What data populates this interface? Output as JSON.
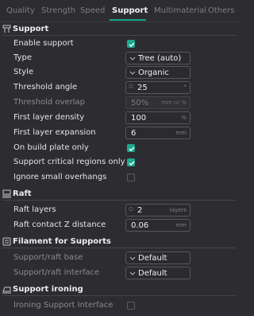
{
  "tabs": {
    "quality": "Quality",
    "strength": "Strength",
    "speed": "Speed",
    "support": "Support",
    "multimaterial": "Multimaterial",
    "others": "Others"
  },
  "colors": {
    "accent": "#1fa88d",
    "background": "#2d2d31"
  },
  "sections": {
    "support": {
      "title": "Support",
      "icon": "support-icon",
      "enable_support": {
        "label": "Enable support",
        "checked": true
      },
      "type": {
        "label": "Type",
        "value": "Tree (auto)"
      },
      "style": {
        "label": "Style",
        "value": "Organic"
      },
      "threshold_angle": {
        "label": "Threshold angle",
        "value": "25",
        "unit": "°"
      },
      "threshold_overlap": {
        "label": "Threshold overlap",
        "value": "50%",
        "unit": "mm or %"
      },
      "first_layer_density": {
        "label": "First layer density",
        "value": "100",
        "unit": "%"
      },
      "first_layer_expansion": {
        "label": "First layer expansion",
        "value": "6",
        "unit": "mm"
      },
      "on_build_plate_only": {
        "label": "On build plate only",
        "checked": true
      },
      "support_critical_regions_only": {
        "label": "Support critical regions only",
        "checked": true
      },
      "ignore_small_overhangs": {
        "label": "Ignore small overhangs",
        "checked": false
      }
    },
    "raft": {
      "title": "Raft",
      "icon": "raft-icon",
      "raft_layers": {
        "label": "Raft layers",
        "value": "2",
        "unit": "layers"
      },
      "raft_contact_z_distance": {
        "label": "Raft contact Z distance",
        "value": "0.06",
        "unit": "mm"
      }
    },
    "filament_for_supports": {
      "title": "Filament for Supports",
      "icon": "filament-icon",
      "support_raft_base": {
        "label": "Support/raft base",
        "value": "Default"
      },
      "support_raft_interface": {
        "label": "Support/raft interface",
        "value": "Default"
      }
    },
    "support_ironing": {
      "title": "Support ironing",
      "icon": "ironing-icon",
      "ironing_support_interface": {
        "label": "Ironing Support Interface",
        "checked": false
      }
    }
  }
}
